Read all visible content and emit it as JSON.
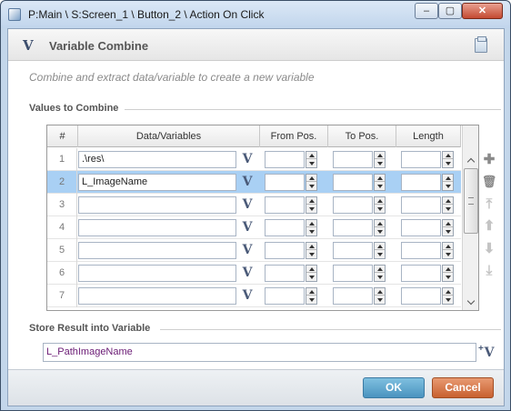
{
  "window": {
    "title": "P:Main \\ S:Screen_1 \\ Button_2 \\ Action On Click",
    "min_glyph": "–",
    "max_glyph": "▢",
    "close_glyph": "✕"
  },
  "header": {
    "logo_glyph": "V",
    "title": "Variable Combine"
  },
  "description": "Combine and extract data/variable to create a new variable",
  "values_section": {
    "label": "Values to Combine",
    "columns": [
      "#",
      "Data/Variables",
      "From Pos.",
      "To Pos.",
      "Length"
    ],
    "rows": [
      {
        "num": "1",
        "value": ".\\res\\",
        "selected": false
      },
      {
        "num": "2",
        "value": "L_ImageName",
        "selected": true
      },
      {
        "num": "3",
        "value": "",
        "selected": false
      },
      {
        "num": "4",
        "value": "",
        "selected": false
      },
      {
        "num": "5",
        "value": "",
        "selected": false
      },
      {
        "num": "6",
        "value": "",
        "selected": false
      },
      {
        "num": "7",
        "value": "",
        "selected": false
      }
    ],
    "variable_glyph": "V",
    "tools": {
      "add_glyph": "✚",
      "delete_glyph": "🗑",
      "move_top_glyph": "⤒",
      "move_up_glyph": "⬆",
      "move_down_glyph": "⬇",
      "move_bottom_glyph": "⤓"
    }
  },
  "result_section": {
    "label": "Store Result into Variable",
    "value": "L_PathImageName",
    "variable_glyph": "V",
    "add_glyph": "+"
  },
  "footer": {
    "ok_label": "OK",
    "cancel_label": "Cancel"
  },
  "colors": {
    "selected_row": "#a9d0f4",
    "ok_button": "#4a93bf",
    "cancel_button": "#c8602f",
    "result_text": "#6a1a74"
  }
}
